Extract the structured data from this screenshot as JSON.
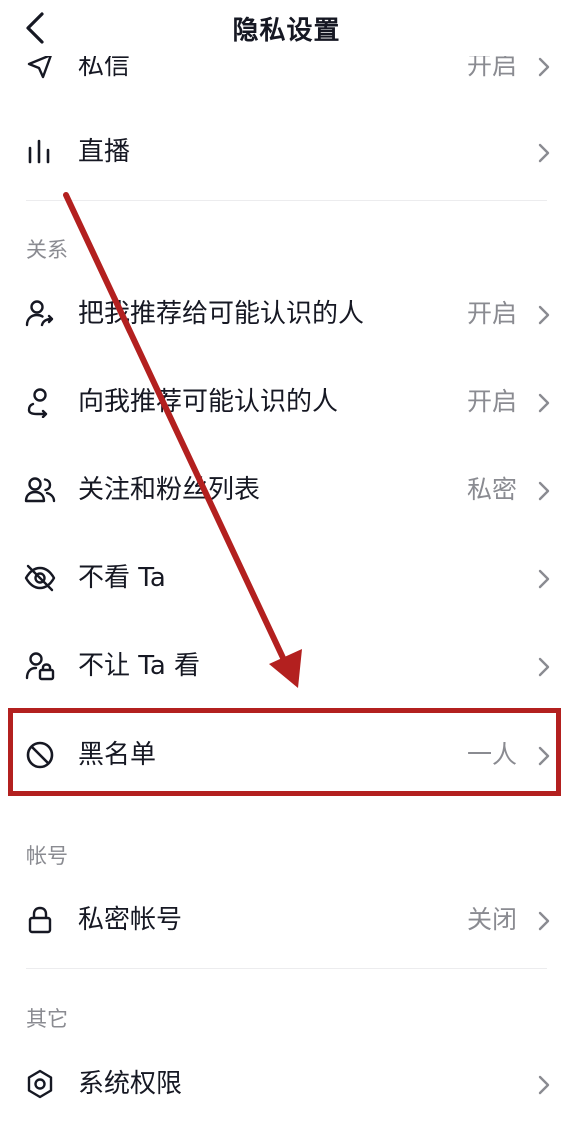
{
  "header": {
    "title": "隐私设置"
  },
  "rows": {
    "messages": {
      "label": "私信",
      "value": "开启"
    },
    "live": {
      "label": "直播",
      "value": ""
    },
    "recommend_me": {
      "label": "把我推荐给可能认识的人",
      "value": "开启"
    },
    "recommend_to_me": {
      "label": "向我推荐可能认识的人",
      "value": "开启"
    },
    "follow_list": {
      "label": "关注和粉丝列表",
      "value": "私密"
    },
    "dont_see": {
      "label": "不看 Ta",
      "value": ""
    },
    "dont_let_see": {
      "label": "不让 Ta 看",
      "value": ""
    },
    "blacklist": {
      "label": "黑名单",
      "value": "一人"
    },
    "private_account": {
      "label": "私密帐号",
      "value": "关闭"
    },
    "system_permissions": {
      "label": "系统权限",
      "value": ""
    }
  },
  "sections": {
    "relations": "关系",
    "account": "帐号",
    "other": "其它"
  },
  "annotation": {
    "color": "#b3201f"
  }
}
